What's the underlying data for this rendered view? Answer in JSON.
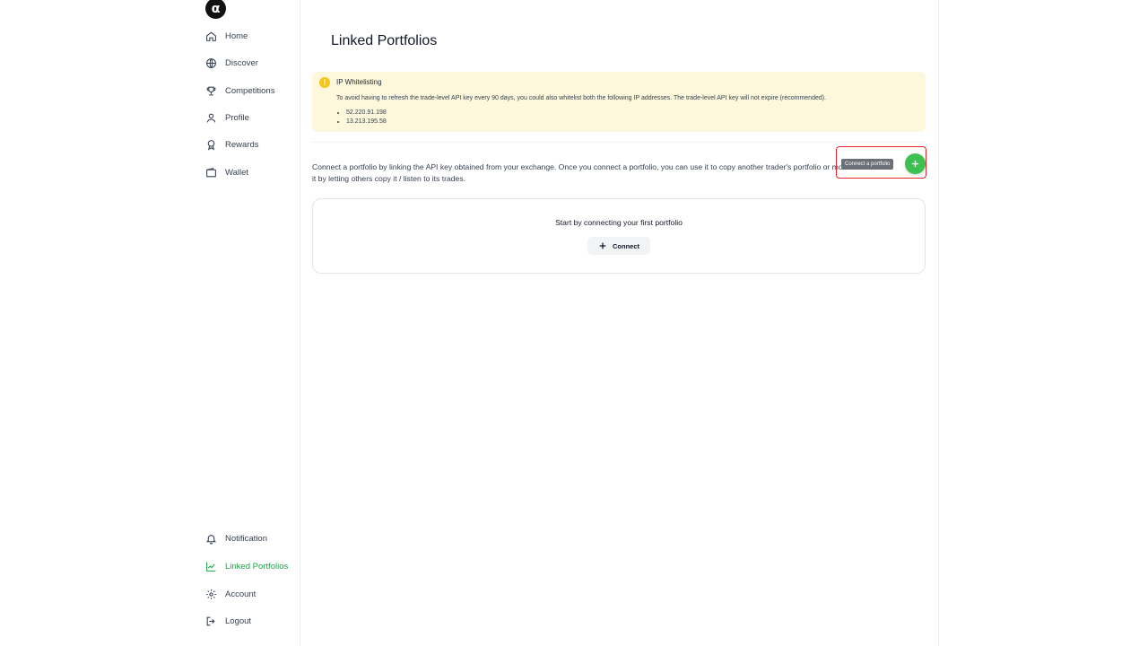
{
  "sidebar": {
    "logo_text": "α",
    "items": [
      {
        "label": "Home",
        "icon": "home-icon"
      },
      {
        "label": "Discover",
        "icon": "globe-icon"
      },
      {
        "label": "Competitions",
        "icon": "trophy-icon"
      },
      {
        "label": "Profile",
        "icon": "user-icon"
      },
      {
        "label": "Rewards",
        "icon": "award-icon"
      },
      {
        "label": "Wallet",
        "icon": "wallet-icon"
      }
    ],
    "bottom_items": [
      {
        "label": "Notification",
        "icon": "bell-icon"
      },
      {
        "label": "Linked Portfolios",
        "icon": "chart-line-icon",
        "active": true
      },
      {
        "label": "Account",
        "icon": "gear-icon"
      },
      {
        "label": "Logout",
        "icon": "logout-icon"
      }
    ]
  },
  "main": {
    "title": "Linked Portfolios",
    "banner": {
      "icon": "exclamation",
      "title": "IP Whitelisting",
      "text": "To avoid having to refresh the trade-level API key every 90 days, you could also whitelist both the following IP addresses. The trade-level API key will not expire (recommended).",
      "ips": [
        "52.220.91.198",
        "13.213.195.58"
      ]
    },
    "description": "Connect a portfolio by linking the API key obtained from your exchange. Once you connect a portfolio, you can use it to copy another trader's portfolio or monetize it by letting others copy it / listen to its trades.",
    "tooltip": "Connect a portfolio",
    "empty_state": {
      "message": "Start by connecting your first portfolio",
      "button_label": "Connect"
    }
  },
  "colors": {
    "accent": "#22a04b",
    "fab": "#3cc04f",
    "banner_bg": "#fdf8dc",
    "warn": "#f5c518",
    "highlight": "#e3262b"
  }
}
